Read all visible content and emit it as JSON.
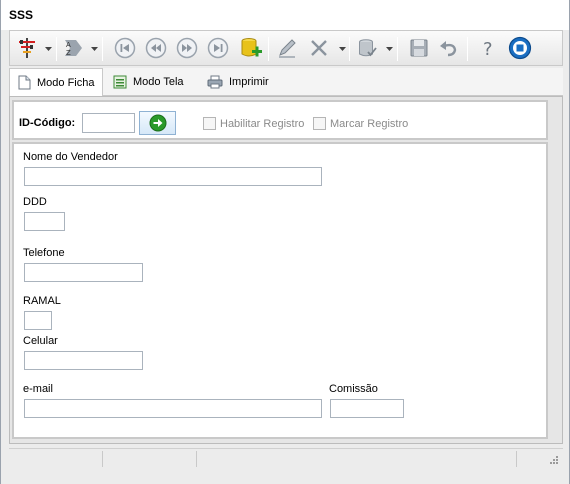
{
  "window": {
    "title": "SSS"
  },
  "toolbar": {
    "buttons": [
      {
        "name": "filter-icon"
      },
      {
        "name": "sort-az-icon"
      },
      {
        "name": "first-record-icon"
      },
      {
        "name": "previous-record-icon"
      },
      {
        "name": "next-record-icon"
      },
      {
        "name": "last-record-icon"
      },
      {
        "name": "add-record-icon"
      },
      {
        "name": "edit-icon"
      },
      {
        "name": "delete-icon"
      },
      {
        "name": "database-icon"
      },
      {
        "name": "save-icon"
      },
      {
        "name": "undo-icon"
      },
      {
        "name": "help-icon"
      },
      {
        "name": "stop-icon"
      }
    ]
  },
  "tabs": [
    {
      "label": "Modo Ficha",
      "icon": "document-icon",
      "active": true
    },
    {
      "label": "Modo Tela",
      "icon": "list-icon",
      "active": false
    },
    {
      "label": "Imprimir",
      "icon": "printer-icon",
      "active": false
    }
  ],
  "id_panel": {
    "label": "ID-Código:",
    "value": "",
    "habilitar_label": "Habilitar Registro",
    "marcar_label": "Marcar Registro"
  },
  "form": {
    "nome_label": "Nome do Vendedor",
    "nome_value": "",
    "ddd_label": "DDD",
    "ddd_value": "",
    "telefone_label": "Telefone",
    "telefone_value": "",
    "ramal_label": "RAMAL",
    "ramal_value": "",
    "celular_label": "Celular",
    "celular_value": "",
    "email_label": "e-mail",
    "email_value": "",
    "comissao_label": "Comissão",
    "comissao_value": ""
  },
  "colors": {
    "accent": "#1a6ec2",
    "go_button": "#2a9a2a",
    "filter_red": "#d42020",
    "db_yellow": "#e8c21a"
  }
}
